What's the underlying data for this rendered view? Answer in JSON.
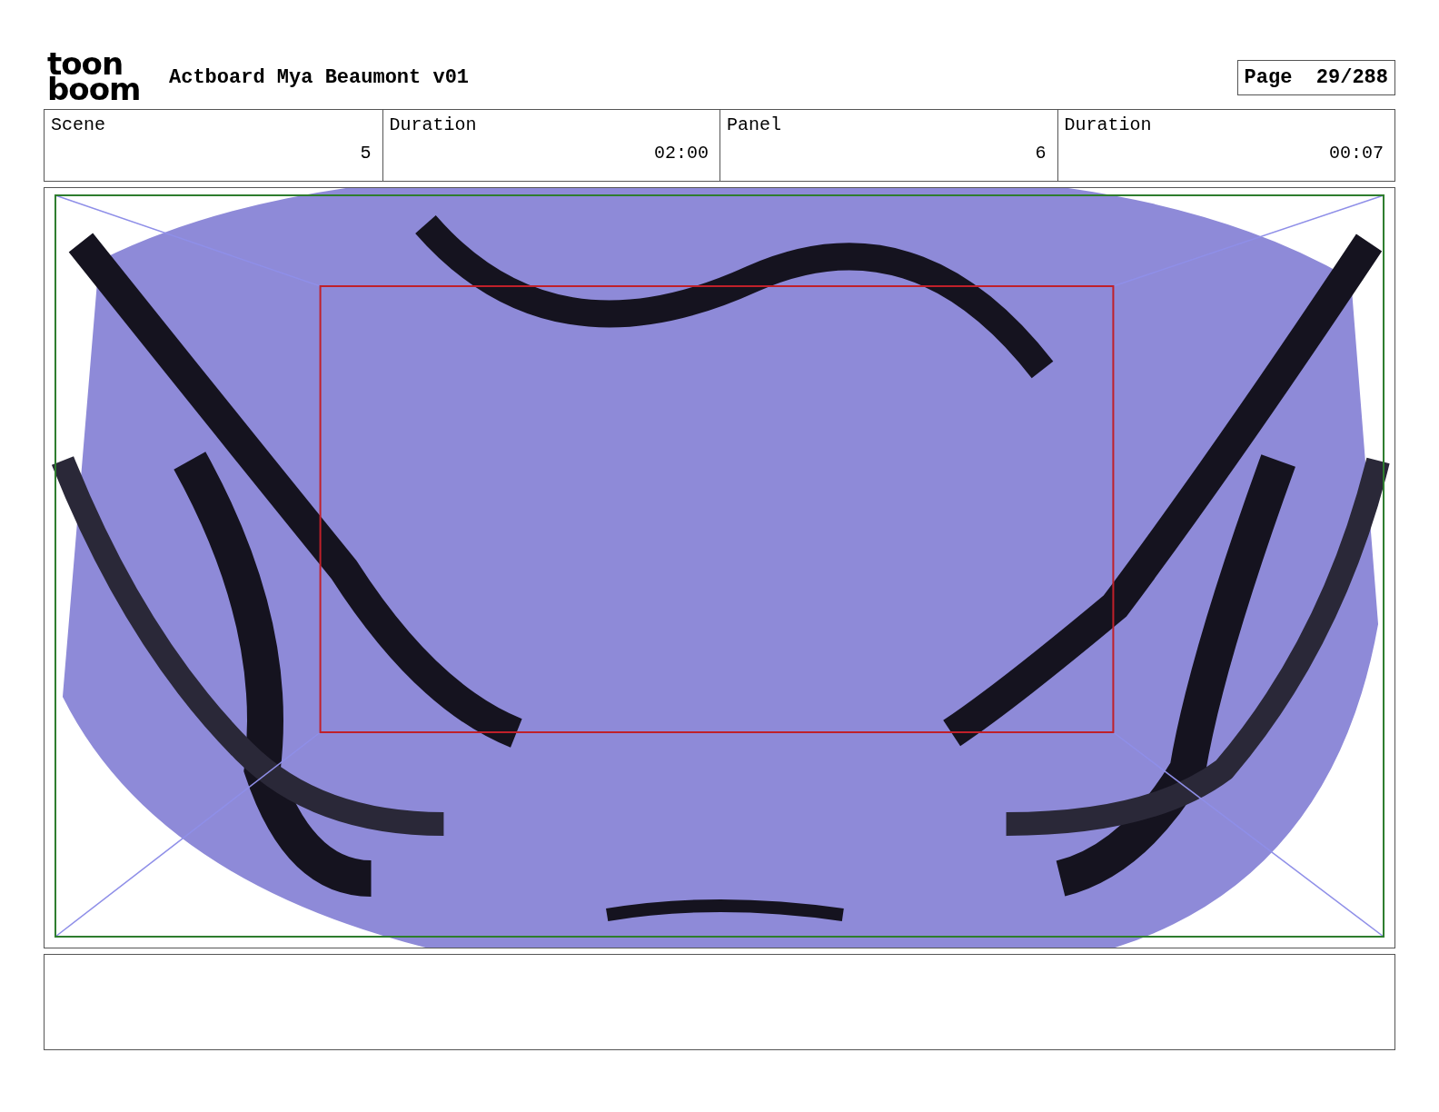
{
  "header": {
    "logo": [
      "toon",
      "boom"
    ],
    "title": "Actboard Mya Beaumont v01",
    "page_label": "Page",
    "page": "29/288"
  },
  "fields": [
    {
      "label": "Scene",
      "value": "5"
    },
    {
      "label": "Duration",
      "value": "02:00"
    },
    {
      "label": "Panel",
      "value": "6"
    },
    {
      "label": "Duration",
      "value": "00:07"
    }
  ]
}
